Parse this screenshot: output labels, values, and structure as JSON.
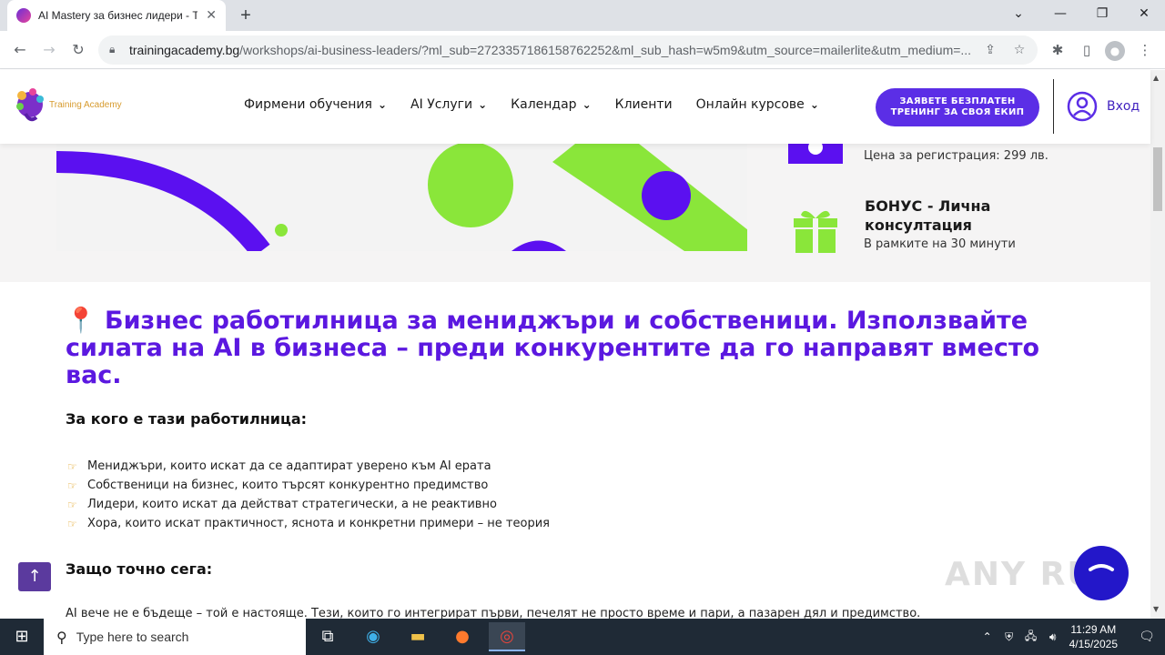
{
  "browser": {
    "tab_title": "AI Mastery за бизнес лидери - T",
    "new_tab": "+",
    "url_host": "trainingacademy.bg",
    "url_path": "/workshops/ai-business-leaders/?ml_sub=2723357186158762252&ml_sub_hash=w5m9&utm_source=mailerlite&utm_medium=...",
    "window_controls": {
      "chevron": "⌄",
      "minimize": "—",
      "restore": "❐",
      "close": "✕"
    }
  },
  "site": {
    "logo_text": "Training Academy",
    "menu": [
      {
        "label": "Фирмени обучения",
        "has_dropdown": true
      },
      {
        "label": "AI Услуги",
        "has_dropdown": true
      },
      {
        "label": "Календар",
        "has_dropdown": true
      },
      {
        "label": "Клиенти",
        "has_dropdown": false
      },
      {
        "label": "Онлайн курсове",
        "has_dropdown": true
      }
    ],
    "cta_line1": "ЗАЯВЕТЕ БЕЗПЛАТЕН",
    "cta_line2": "ТРЕНИНГ ЗА СВОЯ ЕКИП",
    "login": "Вход"
  },
  "info": {
    "price_sub": "Цена за регистрация: 299 лв.",
    "bonus_title": "БОНУС - Лична консултация",
    "bonus_sub": "В рамките на 30 минути"
  },
  "content": {
    "headline": "📍 Бизнес работилница за мениджъри и собственици. Използвайте силата на AI в бизнеса – преди конкурентите да го направят вместо вас.",
    "who_heading": "За кого е тази работилница:",
    "bullets": [
      "Мениджъри, които искат да се адаптират уверено към AI ерата",
      "Собственици на бизнес, които търсят конкурентно предимство",
      "Лидери, които искат да действат стратегически, а не реактивно",
      "Хора, които искат практичност, яснота и конкретни примери – не теория"
    ],
    "why_heading": "Защо точно сега:",
    "paragraph": "AI вече не е бъдеще – той е настояще. Тези, които го интегрират първи, печелят не просто време и пари, а пазарен дял и предимство."
  },
  "watermark": "ANY RUN",
  "taskbar": {
    "search_placeholder": "Type here to search",
    "time": "11:29 AM",
    "date": "4/15/2025"
  },
  "colors": {
    "brand_purple": "#5b18e0",
    "cta": "#5b2ee6",
    "green": "#8ae63a",
    "violet": "#5b10f0"
  }
}
